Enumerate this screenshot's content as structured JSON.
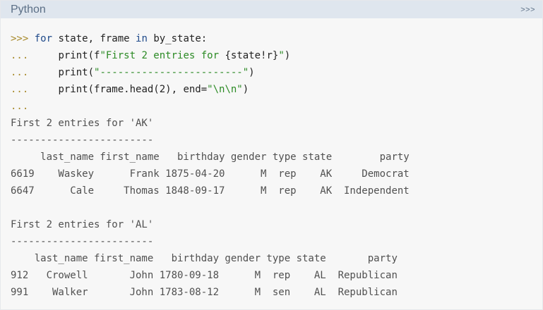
{
  "header": {
    "language": "Python",
    "prompt_toggle": ">>>"
  },
  "code": {
    "p1": ">>> ",
    "l1_kw1": "for",
    "l1_mid": " state, frame ",
    "l1_kw2": "in",
    "l1_end": " by_state:",
    "p2": "...     ",
    "l2_a": "print(f",
    "l2_str": "\"First 2 entries for ",
    "l2_mid": "{state!r}",
    "l2_str2": "\"",
    "l2_end": ")",
    "p3": "...     ",
    "l3_a": "print(",
    "l3_str": "\"------------------------\"",
    "l3_end": ")",
    "p4": "...     ",
    "l4_a": "print(frame.head(2), end=",
    "l4_str": "\"\\n\\n\"",
    "l4_end": ")",
    "p5": "..."
  },
  "output": {
    "ak_title": "First 2 entries for 'AK'",
    "ak_rule": "------------------------",
    "ak_header": "     last_name first_name   birthday gender type state        party",
    "ak_rows": [
      "6619    Waskey      Frank 1875-04-20      M  rep    AK     Democrat",
      "6647      Cale     Thomas 1848-09-17      M  rep    AK  Independent"
    ],
    "al_title": "First 2 entries for 'AL'",
    "al_rule": "------------------------",
    "al_header": "    last_name first_name   birthday gender type state       party",
    "al_rows": [
      "912   Crowell       John 1780-09-18      M  rep    AL  Republican",
      "991    Walker       John 1783-08-12      M  sen    AL  Republican"
    ]
  }
}
